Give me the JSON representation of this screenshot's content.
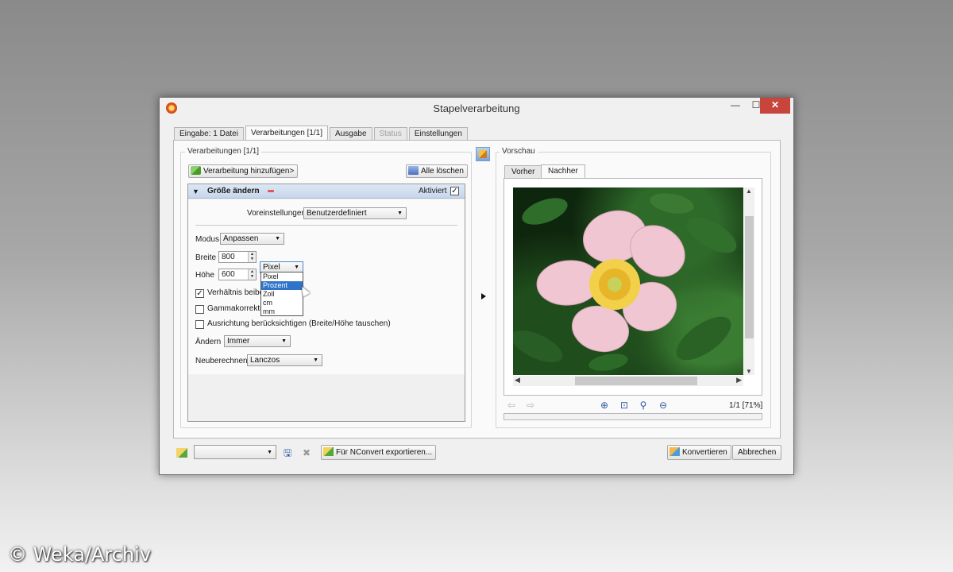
{
  "window": {
    "title": "Stapelverarbeitung",
    "min": "—",
    "max": "☐",
    "close": "✕"
  },
  "tabs": [
    {
      "label": "Eingabe: 1 Datei"
    },
    {
      "label": "Verarbeitungen [1/1]"
    },
    {
      "label": "Ausgabe"
    },
    {
      "label": "Status"
    },
    {
      "label": "Einstellungen"
    }
  ],
  "left": {
    "group_label": "Verarbeitungen [1/1]",
    "add_button": "Verarbeitung hinzufügen>",
    "clear_button": "Alle löschen",
    "panel": {
      "title": "Größe ändern",
      "active_label": "Aktiviert",
      "active_checked": "✓",
      "presets_label": "Voreinstellungen",
      "presets_value": "Benutzerdefiniert",
      "mode_label": "Modus",
      "mode_value": "Anpassen",
      "width_label": "Breite",
      "width_value": "800",
      "height_label": "Höhe",
      "height_value": "600",
      "unit_value": "Pixel",
      "unit_options": [
        "Pixel",
        "Prozent",
        "Zoll",
        "cm",
        "mm"
      ],
      "unit_highlighted": "Prozent",
      "keep_ratio_label": "Verhältnis beibe",
      "keep_ratio_checked": "✓",
      "gamma_label": "Gammakorrektur",
      "orientation_label": "Ausrichtung berücksichtigen (Breite/Höhe tauschen)",
      "change_label": "Ändern",
      "change_value": "Immer",
      "resample_label": "Neuberechnen",
      "resample_value": "Lanczos"
    }
  },
  "preview": {
    "group_label": "Vorschau",
    "tab_before": "Vorher",
    "tab_after": "Nachher",
    "page_status": "1/1 [71%]"
  },
  "bottom": {
    "export_button": "Für NConvert exportieren...",
    "convert_button": "Konvertieren",
    "cancel_button": "Abbrechen"
  },
  "watermark": "© Weka/Archiv",
  "colors": {
    "close_button": "#c7453a",
    "panel_header": "#c6d6ea",
    "selection": "#2f74c8"
  }
}
